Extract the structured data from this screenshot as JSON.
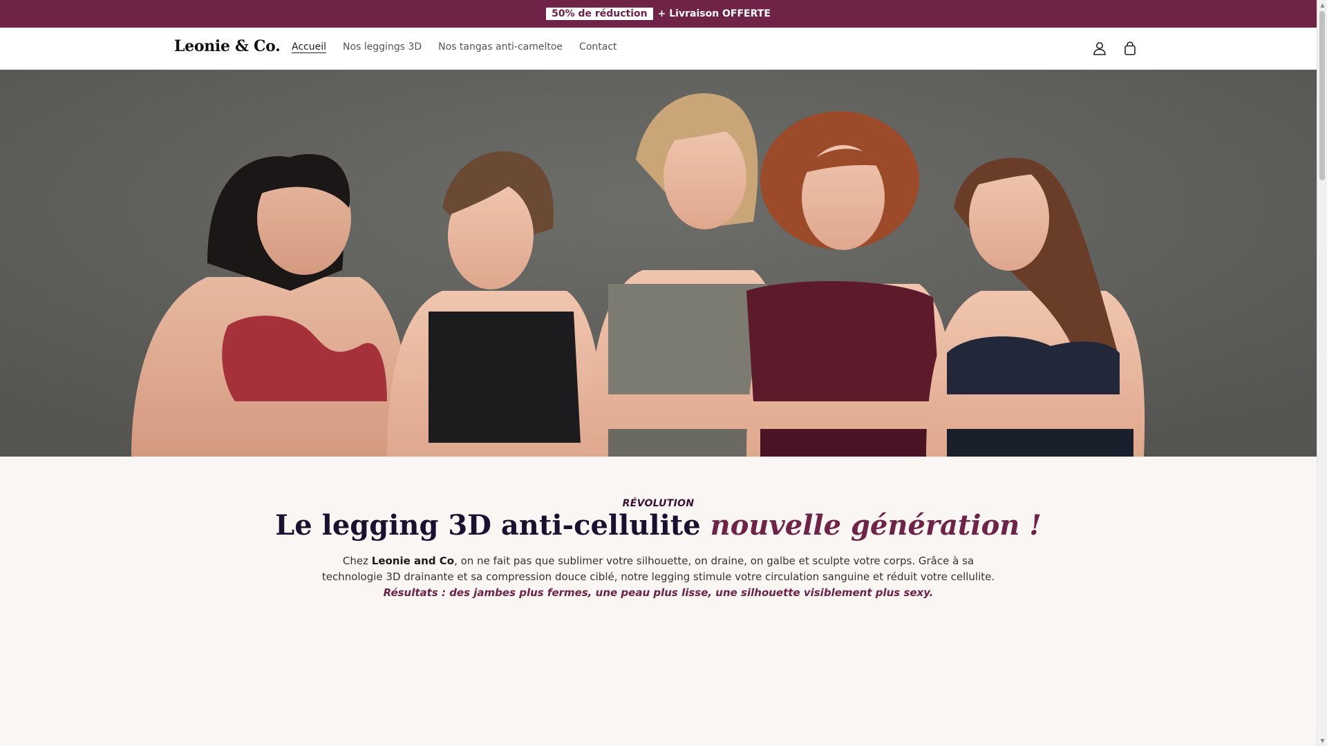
{
  "announcement": {
    "badge": "50% de réduction",
    "text": "+ Livraison OFFERTE"
  },
  "header": {
    "logo": "Leonie & Co.",
    "nav": [
      {
        "label": "Accueil",
        "active": true
      },
      {
        "label": "Nos leggings 3D",
        "active": false
      },
      {
        "label": "Nos tangas anti-cameltoe",
        "active": false
      },
      {
        "label": "Contact",
        "active": false
      }
    ],
    "icons": [
      "account-icon",
      "cart-icon"
    ]
  },
  "hero": {
    "outfits": [
      {
        "top": "red sports bra",
        "color": "#a5323b"
      },
      {
        "top": "black crop top",
        "color": "#1c1c1e"
      },
      {
        "top": "grey crop top",
        "color": "#7c7b72"
      },
      {
        "top": "burgundy long-sleeve top",
        "color": "#5c1a2b"
      },
      {
        "top": "navy sports bra",
        "color": "#22283a"
      }
    ]
  },
  "intro": {
    "eyebrow": "RÉVOLUTION",
    "headline_main": "Le legging 3D anti-cellulite",
    "headline_accent": "nouvelle génération !",
    "body_prefix": "Chez ",
    "body_brand": "Leonie and Co",
    "body_rest": ", on ne fait pas que sublimer votre silhouette, on draine, on galbe et sculpte votre corps. Grâce à sa technologie 3D drainante et sa compression douce ciblé, notre legging stimule votre circulation sanguine et réduit votre cellulite.",
    "results": "Résultats : des jambes plus fermes, une peau plus lisse, une silhouette visiblement plus sexy."
  },
  "colors": {
    "brand": "#6e2347",
    "background": "#faf6f3",
    "headline": "#1b1030"
  }
}
